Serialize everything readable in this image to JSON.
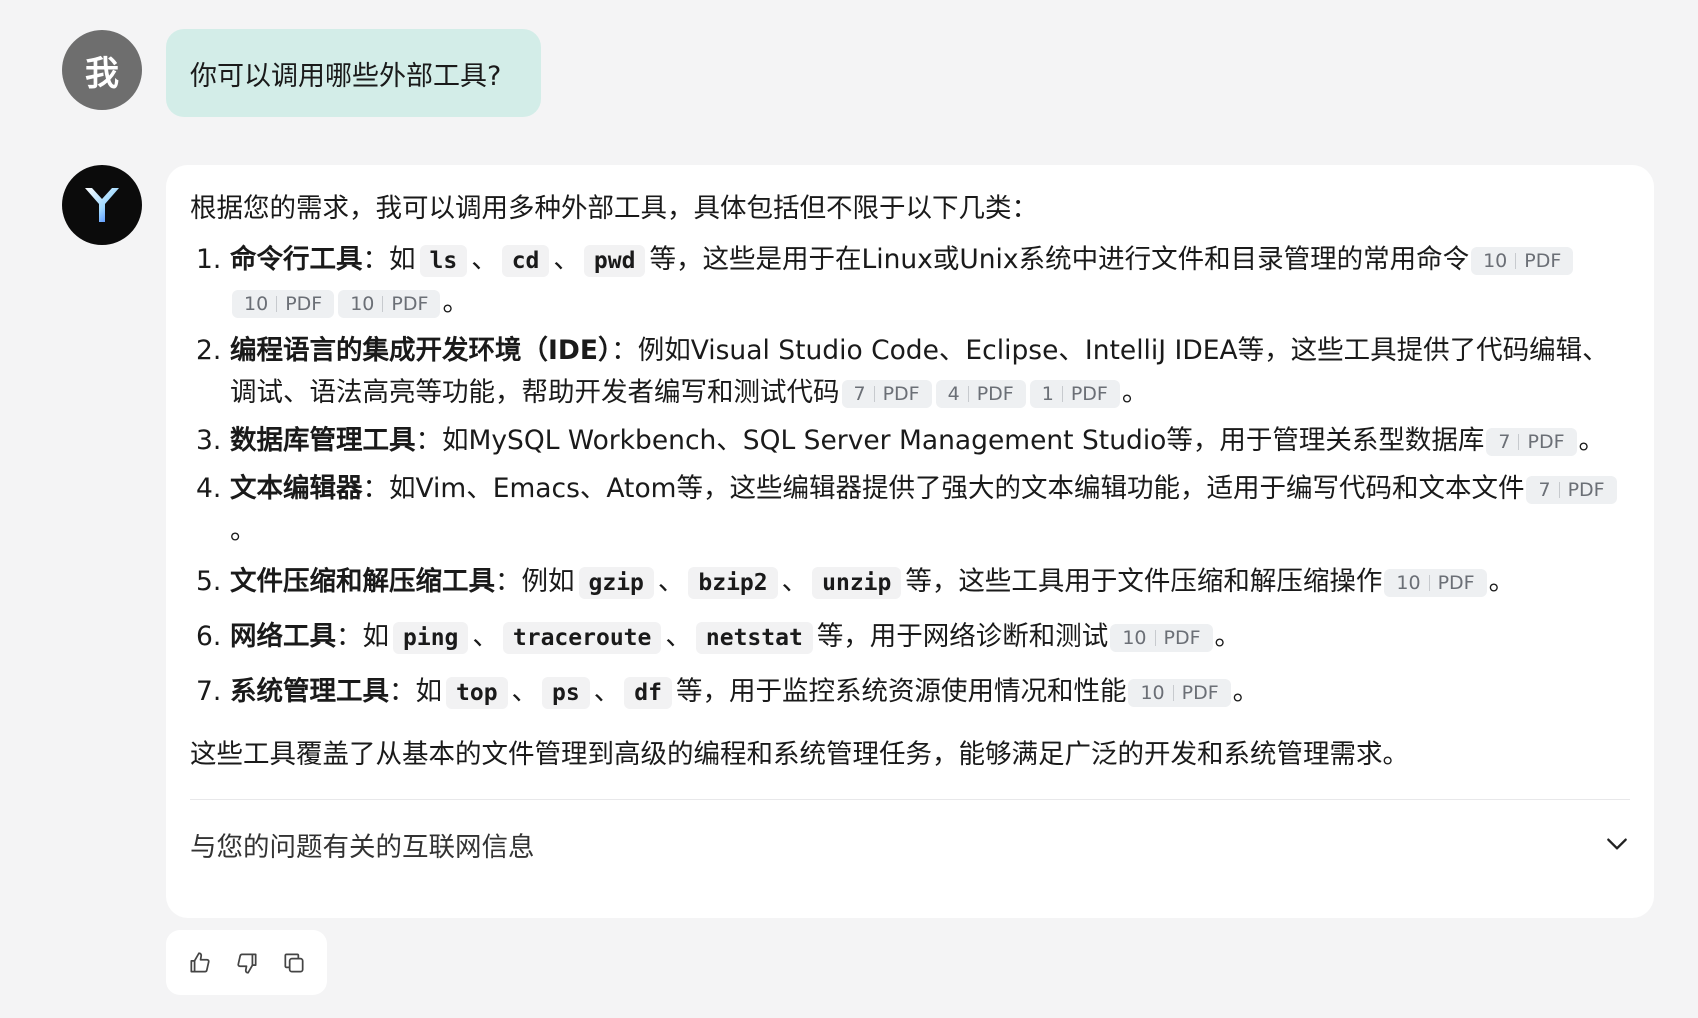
{
  "user": {
    "avatar_text": "我",
    "message": "你可以调用哪些外部工具?"
  },
  "assistant": {
    "logo_icon": "y-logo-icon",
    "intro": "根据您的需求，我可以调用多种外部工具，具体包括但不限于以下几类：",
    "items": [
      {
        "num": "1.",
        "title": "命令行工具",
        "lead": "：如",
        "codes": [
          "ls",
          "cd",
          "pwd"
        ],
        "sep": "、",
        "text": "等，这些是用于在Linux或Unix系统中进行文件和目录管理的常用命令",
        "cites": [
          {
            "n": "10",
            "t": "PDF"
          },
          {
            "n": "10",
            "t": "PDF"
          },
          {
            "n": "10",
            "t": "PDF"
          }
        ],
        "end": "。"
      },
      {
        "num": "2.",
        "title": "编程语言的集成开发环境（IDE）",
        "text": "：例如Visual Studio Code、Eclipse、IntelliJ IDEA等，这些工具提供了代码编辑、调试、语法高亮等功能，帮助开发者编写和测试代码",
        "cites": [
          {
            "n": "7",
            "t": "PDF"
          },
          {
            "n": "4",
            "t": "PDF"
          },
          {
            "n": "1",
            "t": "PDF"
          }
        ],
        "end": "。"
      },
      {
        "num": "3.",
        "title": "数据库管理工具",
        "text": "：如MySQL Workbench、SQL Server Management Studio等，用于管理关系型数据库",
        "cites": [
          {
            "n": "7",
            "t": "PDF"
          }
        ],
        "end": "。"
      },
      {
        "num": "4.",
        "title": "文本编辑器",
        "text": "：如Vim、Emacs、Atom等，这些编辑器提供了强大的文本编辑功能，适用于编写代码和文本文件",
        "cites": [
          {
            "n": "7",
            "t": "PDF"
          }
        ],
        "end": "。"
      },
      {
        "num": "5.",
        "title": "文件压缩和解压缩工具",
        "lead": "：例如",
        "codes": [
          "gzip",
          "bzip2",
          "unzip"
        ],
        "sep": "、",
        "text": "等，这些工具用于文件压缩和解压缩操作",
        "cites": [
          {
            "n": "10",
            "t": "PDF"
          }
        ],
        "end": "。"
      },
      {
        "num": "6.",
        "title": "网络工具",
        "lead": "：如",
        "codes": [
          "ping",
          "traceroute",
          "netstat"
        ],
        "sep": "、",
        "text": "等，用于网络诊断和测试",
        "cites": [
          {
            "n": "10",
            "t": "PDF"
          }
        ],
        "end": "。"
      },
      {
        "num": "7.",
        "title": "系统管理工具",
        "lead": "：如",
        "codes": [
          "top",
          "ps",
          "df"
        ],
        "sep": "、",
        "text": "等，用于监控系统资源使用情况和性能",
        "cites": [
          {
            "n": "10",
            "t": "PDF"
          }
        ],
        "end": "。"
      }
    ],
    "outro": "这些工具覆盖了从基本的文件管理到高级的编程和系统管理任务，能够满足广泛的开发和系统管理需求。",
    "web_info_label": "与您的问题有关的互联网信息"
  },
  "feedback": {
    "icons": [
      "thumbs-up-icon",
      "thumbs-down-icon",
      "copy-icon"
    ]
  },
  "colors": {
    "user_bubble": "#d3ede8",
    "page_bg": "#f4f4f5",
    "cite_bg": "#eef0f2"
  }
}
